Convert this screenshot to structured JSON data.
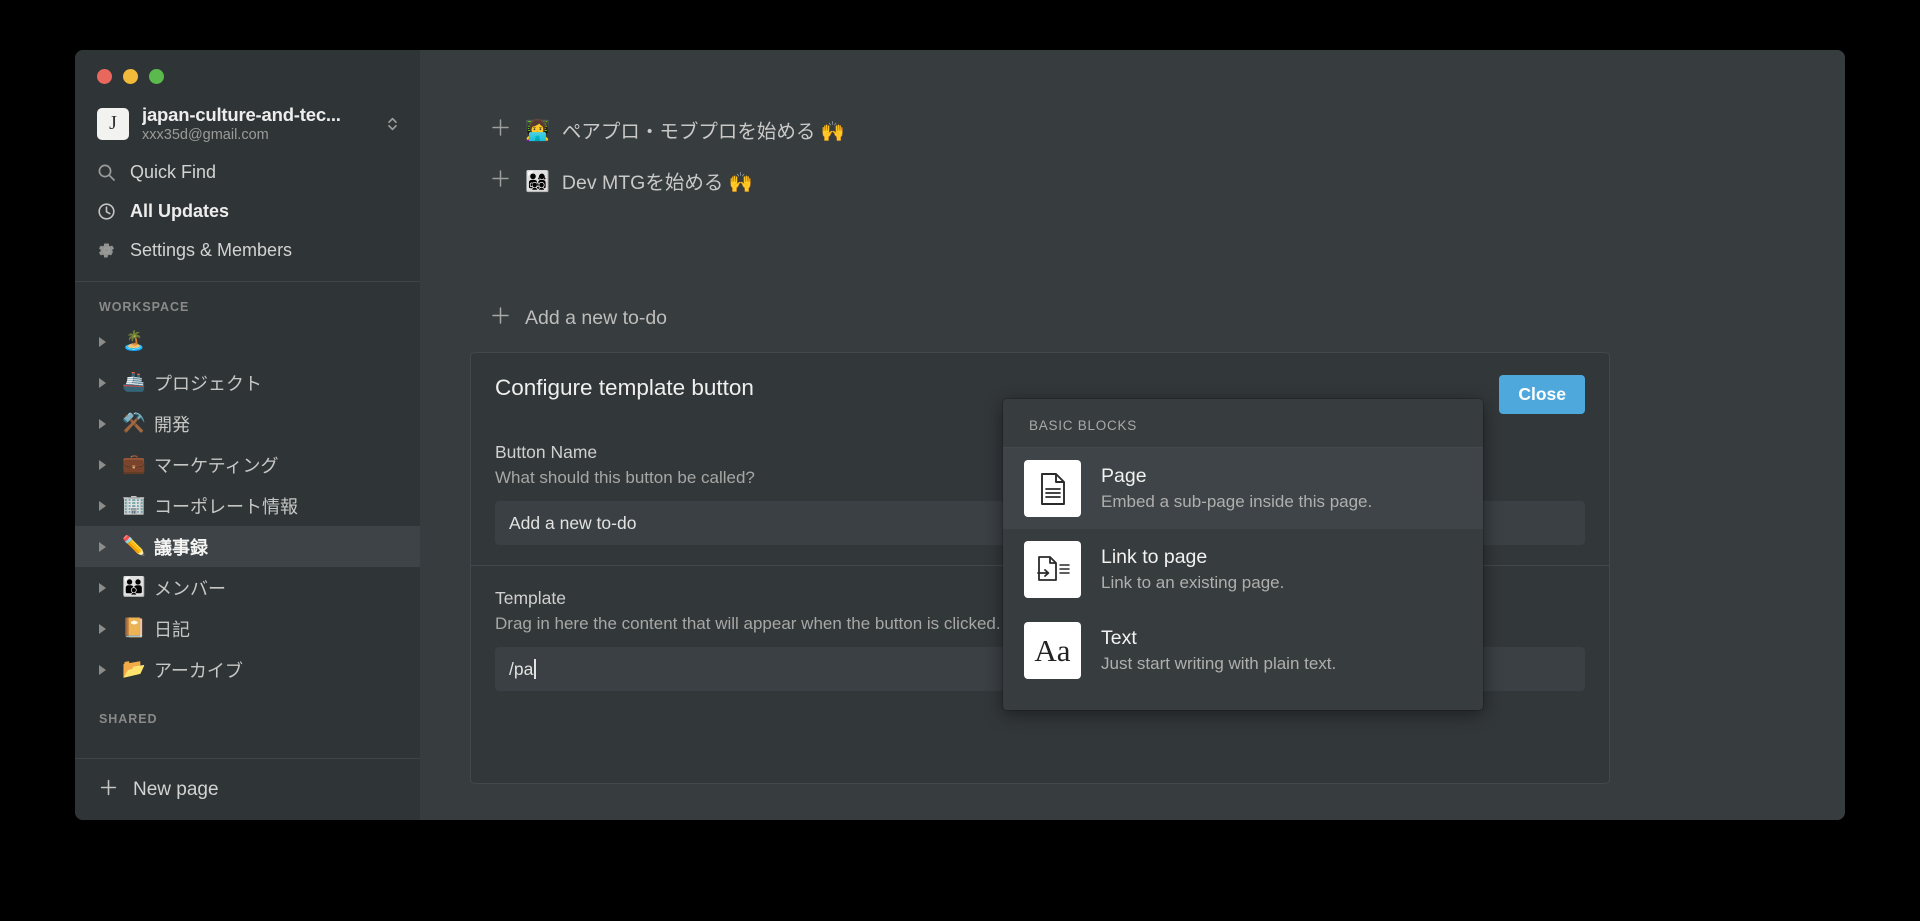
{
  "window": {
    "traffic_lights": [
      {
        "name": "close",
        "color": "#E8685D"
      },
      {
        "name": "minimize",
        "color": "#F2BA3A"
      },
      {
        "name": "maximize",
        "color": "#5BB94D"
      }
    ]
  },
  "sidebar": {
    "workspace": {
      "avatar_letter": "J",
      "name": "japan-culture-and-tec...",
      "email": "xxx35d@gmail.com"
    },
    "nav": [
      {
        "icon": "search-icon",
        "label": "Quick Find",
        "strong": false
      },
      {
        "icon": "clock-icon",
        "label": "All Updates",
        "strong": true
      },
      {
        "icon": "gear-icon",
        "label": "Settings & Members",
        "strong": false
      }
    ],
    "workspace_section": {
      "heading": "WORKSPACE",
      "pages": [
        {
          "emoji": "🏝️",
          "label": "",
          "selected": false
        },
        {
          "emoji": "🚢",
          "label": "プロジェクト",
          "selected": false
        },
        {
          "emoji": "⚒️",
          "label": "開発",
          "selected": false
        },
        {
          "emoji": "💼",
          "label": "マーケティング",
          "selected": false
        },
        {
          "emoji": "🏢",
          "label": "コーポレート情報",
          "selected": false
        },
        {
          "emoji": "✏️",
          "label": "議事録",
          "selected": true
        },
        {
          "emoji": "👪",
          "label": "メンバー",
          "selected": false
        },
        {
          "emoji": "📔",
          "label": "日記",
          "selected": false
        },
        {
          "emoji": "📂",
          "label": "アーカイブ",
          "selected": false
        }
      ]
    },
    "shared_section": {
      "heading": "SHARED"
    },
    "new_page": {
      "icon": "plus-icon",
      "label": "New page"
    }
  },
  "main": {
    "template_buttons": [
      {
        "emoji": "👩‍💻",
        "label": "ペアプロ・モブプロを始める 🙌"
      },
      {
        "emoji": "👨‍👩‍👧‍👦",
        "label": "Dev MTGを始める 🙌"
      }
    ],
    "add_todo": {
      "icon": "plus-icon",
      "label": "Add a new to-do"
    }
  },
  "config_panel": {
    "title": "Configure template button",
    "close_label": "Close",
    "button_name_label": "Button Name",
    "button_name_sublabel": "What should this button be called?",
    "button_name_value": "Add a new to-do",
    "template_label": "Template",
    "template_sublabel": "Drag in here the content that will appear when the button is clicked.",
    "template_value": "/pa"
  },
  "block_menu": {
    "heading": "BASIC BLOCKS",
    "items": [
      {
        "icon": "page-icon",
        "title": "Page",
        "desc": "Embed a sub-page inside this page.",
        "active": true
      },
      {
        "icon": "link-to-page-icon",
        "title": "Link to page",
        "desc": "Link to an existing page.",
        "active": false
      },
      {
        "icon": "text-aa-icon",
        "title": "Text",
        "desc": "Just start writing with plain text.",
        "active": false
      }
    ]
  },
  "colors": {
    "window_bg": "#373C3F",
    "sidebar_bg": "#2F3437",
    "panel_bg": "#32373A",
    "accent_blue": "#4FA8DB",
    "menu_bg": "#373C3F",
    "menu_active": "#3E4447"
  }
}
